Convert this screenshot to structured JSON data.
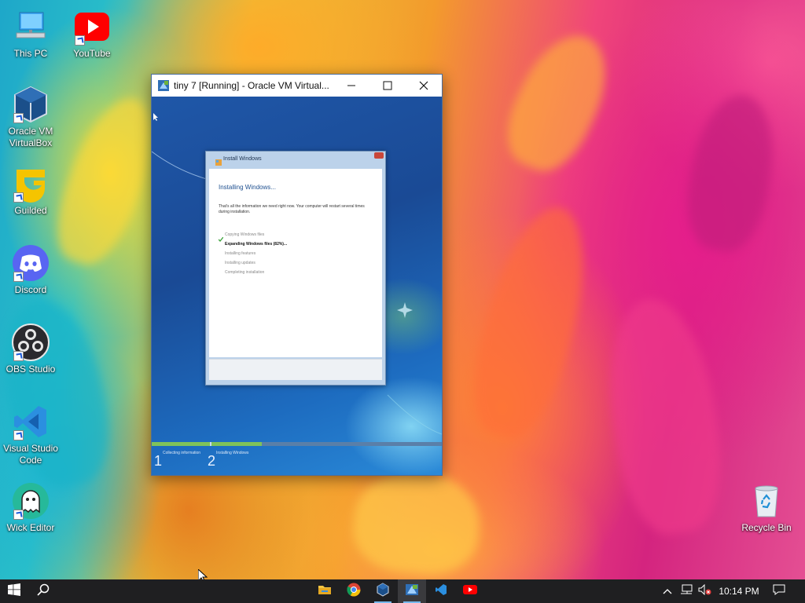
{
  "desktop": {
    "icons": [
      {
        "label": "This PC"
      },
      {
        "label": "YouTube"
      },
      {
        "label": "Oracle VM\nVirtualBox"
      },
      {
        "label": "Guilded"
      },
      {
        "label": "Discord"
      },
      {
        "label": "OBS Studio"
      },
      {
        "label": "Visual Studio\nCode"
      },
      {
        "label": "Wick Editor"
      },
      {
        "label": "Recycle Bin"
      }
    ]
  },
  "vm_window": {
    "title": "tiny 7 [Running] - Oracle VM Virtual...",
    "setup": {
      "title": "Install Windows",
      "heading": "Installing Windows...",
      "description": "That's all the information we need right now. Your computer will restart several times during installation.",
      "steps": [
        {
          "label": "Copying Windows files",
          "state": "done"
        },
        {
          "label": "Expanding Windows files (82%)...",
          "state": "active"
        },
        {
          "label": "Installing features",
          "state": "pending"
        },
        {
          "label": "Installing updates",
          "state": "pending"
        },
        {
          "label": "Completing installation",
          "state": "pending"
        }
      ]
    },
    "progress": {
      "fill_fraction": 0.38,
      "phases": [
        {
          "number": "1",
          "label": "Collecting information"
        },
        {
          "number": "2",
          "label": "Installing Windows"
        }
      ]
    }
  },
  "taskbar": {
    "apps": [
      "file-explorer",
      "chrome",
      "virtualbox",
      "virtualbox-vm",
      "vscode",
      "youtube"
    ],
    "clock": "10:14 PM"
  },
  "colors": {
    "taskbar": "#1f1f21",
    "accent": "#76b9ed",
    "progress": "#7fc25a"
  }
}
